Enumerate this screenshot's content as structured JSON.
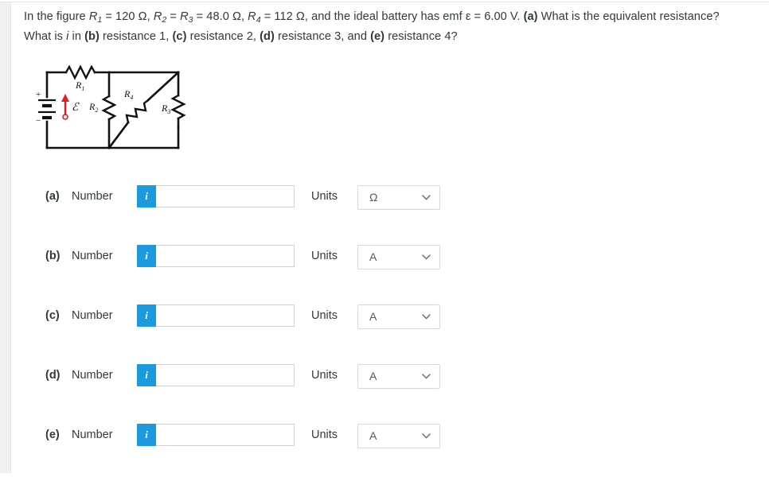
{
  "question": {
    "line1_pre": "In the figure ",
    "r1_sym": "R",
    "r1_sub": "1",
    "r1_val": " = 120 Ω, ",
    "r2_sym": "R",
    "r2_sub": "2",
    "r2_eq": " = ",
    "r3_sym": "R",
    "r3_sub": "3",
    "r3_val": " = 48.0 Ω, ",
    "r4_sym": "R",
    "r4_sub": "4",
    "r4_val": " = 112 Ω, and the ideal battery has emf ",
    "emf_sym": "ε",
    "emf_val": " = 6.00 V. ",
    "part_a": "(a)",
    "part_a_text": " What is the equivalent resistance?",
    "line2_pre": "What is ",
    "i_sym": "i",
    "line2_mid": " in ",
    "part_b": "(b)",
    "part_b_text": " resistance 1, ",
    "part_c": "(c)",
    "part_c_text": " resistance 2, ",
    "part_d": "(d)",
    "part_d_text": " resistance 3, and ",
    "part_e": "(e)",
    "part_e_text": " resistance 4?"
  },
  "figure": {
    "name": "circuit-diagram",
    "battery_plus": "+",
    "battery_minus": "−",
    "emf_label": "ℰ",
    "r1_label": "R",
    "r1_sub": "1",
    "r2_label": "R",
    "r2_sub": "2",
    "r3_label": "R",
    "r3_sub": "3",
    "r4_label": "R",
    "r4_sub": "4",
    "arrow_color": "#e02020",
    "wire_color": "#111111"
  },
  "answer_rows": [
    {
      "letter": "(a)",
      "number_label": "Number",
      "info_glyph": "i",
      "value": "",
      "placeholder": "",
      "units_label": "Units",
      "unit": "Ω"
    },
    {
      "letter": "(b)",
      "number_label": "Number",
      "info_glyph": "i",
      "value": "",
      "placeholder": "",
      "units_label": "Units",
      "unit": "A"
    },
    {
      "letter": "(c)",
      "number_label": "Number",
      "info_glyph": "i",
      "value": "",
      "placeholder": "",
      "units_label": "Units",
      "unit": "A"
    },
    {
      "letter": "(d)",
      "number_label": "Number",
      "info_glyph": "i",
      "value": "",
      "placeholder": "",
      "units_label": "Units",
      "unit": "A"
    },
    {
      "letter": "(e)",
      "number_label": "Number",
      "info_glyph": "i",
      "value": "",
      "placeholder": "",
      "units_label": "Units",
      "unit": "A"
    }
  ],
  "colors": {
    "accent": "#1b9ae0",
    "text": "#31393d",
    "border": "#d2d2d2",
    "gutter": "#f0f0f0"
  }
}
